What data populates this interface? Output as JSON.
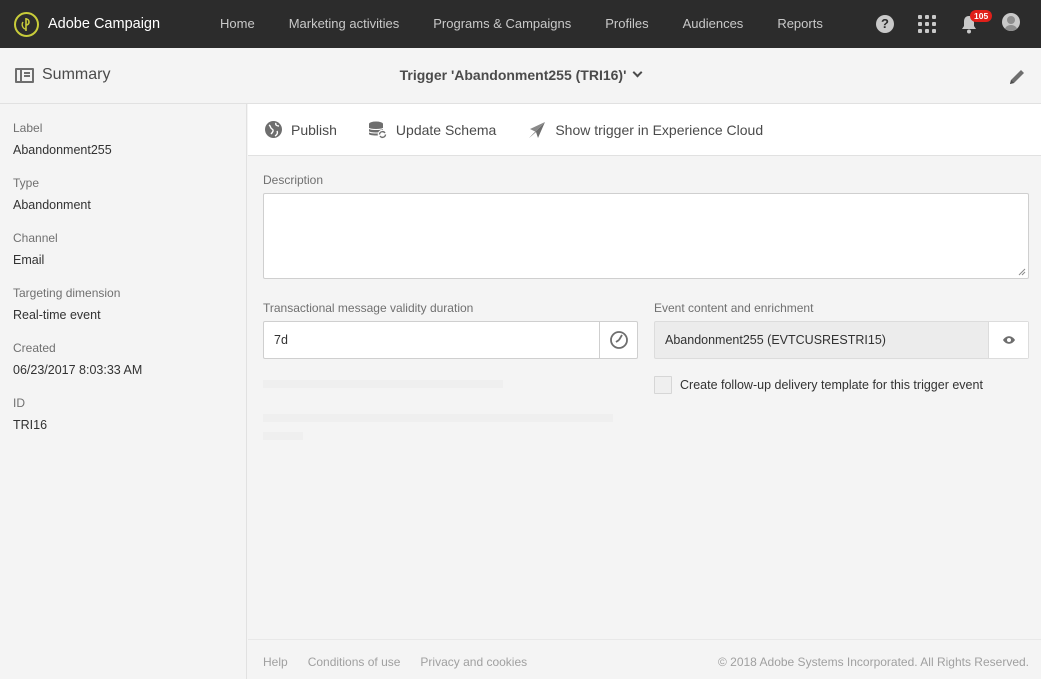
{
  "topbar": {
    "app_name": "Adobe Campaign",
    "nav": [
      "Home",
      "Marketing activities",
      "Programs & Campaigns",
      "Profiles",
      "Audiences",
      "Reports"
    ],
    "notification_count": "105",
    "help_glyph": "?"
  },
  "header": {
    "summary_label": "Summary",
    "title": "Trigger 'Abandonment255 (TRI16)'"
  },
  "summary": {
    "fields": [
      {
        "label": "Label",
        "value": "Abandonment255"
      },
      {
        "label": "Type",
        "value": "Abandonment"
      },
      {
        "label": "Channel",
        "value": "Email"
      },
      {
        "label": "Targeting dimension",
        "value": "Real-time event"
      },
      {
        "label": "Created",
        "value": "06/23/2017 8:03:33 AM"
      },
      {
        "label": "ID",
        "value": "TRI16"
      }
    ]
  },
  "toolbar": {
    "publish": "Publish",
    "update_schema": "Update Schema",
    "show_trigger": "Show trigger in Experience Cloud"
  },
  "form": {
    "description_label": "Description",
    "description_value": "",
    "validity_label": "Transactional message validity duration",
    "validity_value": "7d",
    "event_label": "Event content and enrichment",
    "event_value": "Abandonment255 (EVTCUSRESTRI15)",
    "followup_label": "Create follow-up delivery template for this trigger event",
    "followup_checked": false
  },
  "footer": {
    "links": [
      "Help",
      "Conditions of use",
      "Privacy and cookies"
    ],
    "copyright": "© 2018 Adobe Systems Incorporated. All Rights Reserved."
  },
  "colors": {
    "topbar_bg": "#2c2c2c",
    "badge": "#e0201a",
    "logo_ring": "#c8cc3a"
  }
}
